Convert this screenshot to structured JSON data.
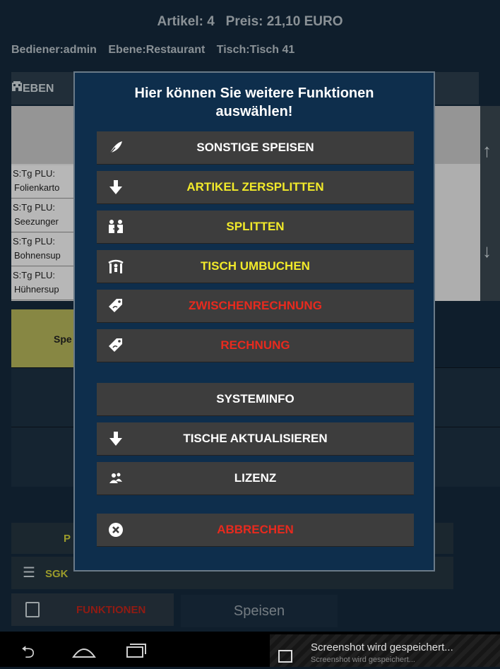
{
  "header": {
    "artikel": "Artikel: 4",
    "preis": "Preis: 21,10 EURO",
    "bediener": "Bediener:admin",
    "ebene": "Ebene:Restaurant",
    "tisch": "Tisch:Tisch 41"
  },
  "ebene_label": "EBEN",
  "list_rows": [
    {
      "line1": "S:Tg  PLU:",
      "line2": "Folienkarto"
    },
    {
      "line1": "S:Tg  PLU:",
      "line2": "Seezunger"
    },
    {
      "line1": "S:Tg  PLU:",
      "line2": "Bohnensup"
    },
    {
      "line1": "S:Tg  PLU:",
      "line2": "Hühnersup"
    }
  ],
  "yellow_cell": "Spe",
  "bottom": {
    "row1_partial": "P",
    "sgk": "SGK",
    "funktionen": "FUNKTIONEN",
    "speisen_tab": "Speisen"
  },
  "dialog": {
    "title": "Hier können Sie weitere Funktionen auswählen!",
    "buttons": [
      {
        "label": "SONSTIGE SPEISEN",
        "icon": "feather-icon",
        "color": "#ffffff"
      },
      {
        "label": "ARTIKEL ZERSPLITTEN",
        "icon": "arrow-down-icon",
        "color": "#f2ea2a"
      },
      {
        "label": "SPLITTEN",
        "icon": "people-split-icon",
        "color": "#f2ea2a"
      },
      {
        "label": "TISCH UMBUCHEN",
        "icon": "table-move-icon",
        "color": "#f2ea2a"
      },
      {
        "label": "ZWISCHENRECHNUNG",
        "icon": "tag-icon",
        "color": "#e82a1e"
      },
      {
        "label": "RECHNUNG",
        "icon": "tag-icon",
        "color": "#e82a1e"
      },
      {
        "label": "SYSTEMINFO",
        "icon": "",
        "color": "#ffffff"
      },
      {
        "label": "TISCHE AKTUALISIEREN",
        "icon": "arrow-down-icon",
        "color": "#ffffff"
      },
      {
        "label": "LIZENZ",
        "icon": "users-icon",
        "color": "#ffffff"
      },
      {
        "label": "ABBRECHEN",
        "icon": "cancel-icon",
        "color": "#e82a1e"
      }
    ]
  },
  "notification": {
    "title": "Screenshot wird gespeichert...",
    "subtitle": "Screenshot wird gespeichert..."
  }
}
